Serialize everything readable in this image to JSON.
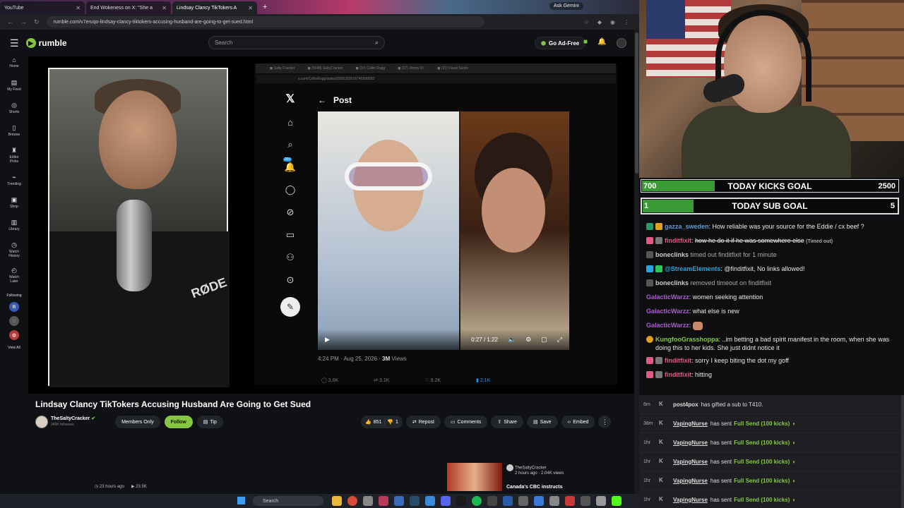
{
  "browser": {
    "tabs": [
      {
        "label": "YouTube",
        "active": false
      },
      {
        "label": "End Wokeness on X: \"She a",
        "active": false
      },
      {
        "label": "Lindsay Clancy TikTokers A",
        "active": true
      }
    ],
    "ask_gemini": "Ask Gemini",
    "url": "rumble.com/v7eruqo-lindsay-clancy-tiktokers-accusing-husband-are-going-to-get-sued.html"
  },
  "header": {
    "logo": "rumble",
    "search_placeholder": "Search",
    "go_ad_free": "Go Ad-Free"
  },
  "sidebar": {
    "items": [
      {
        "label": "Home",
        "icon": "home-icon"
      },
      {
        "label": "My Feed",
        "icon": "feed-icon"
      },
      {
        "label": "Shorts",
        "icon": "shorts-icon"
      },
      {
        "label": "Browse",
        "icon": "browse-icon"
      },
      {
        "label": "Editor Picks",
        "icon": "picks-icon"
      },
      {
        "label": "Trending",
        "icon": "trending-icon"
      },
      {
        "label": "Shop",
        "icon": "shop-icon"
      },
      {
        "label": "Library",
        "icon": "library-icon"
      },
      {
        "label": "Watch History",
        "icon": "history-icon"
      },
      {
        "label": "Watch Later",
        "icon": "later-icon"
      }
    ],
    "following_label": "Following",
    "view_all": "View All"
  },
  "post": {
    "header": "Post",
    "fake_url": "x.com/CollinRugg/status/2092392616746996093",
    "notif_count": "20+",
    "time": "0:27 / 1:22",
    "meta": "4:24 PM · Aug 25, 2026 · ",
    "views": "3M",
    "views_label": " Views",
    "actions": [
      "3.6K",
      "3.1K",
      "9.2K",
      "2.1K"
    ]
  },
  "video": {
    "title": "Lindsay Clancy TikTokers Accusing Husband Are Going to Get Sued",
    "channel": "TheSaltyCracker",
    "followers": "349K followers",
    "members_only": "Members Only",
    "follow": "Follow",
    "tip": "Tip",
    "upvotes": "851",
    "downvotes": "1",
    "repost": "Repost",
    "comments": "Comments",
    "share": "Share",
    "save": "Save",
    "embed": "Embed",
    "posted": "23 hours ago",
    "views": "23.5K"
  },
  "related": {
    "channel": "TheSaltyCracker",
    "meta": "2 hours ago · 2.04K views",
    "title": "Canada's CBC instructs"
  },
  "taskbar": {
    "search": "Search"
  },
  "goals": [
    {
      "current": "700",
      "label": "TODAY KICKS GOAL",
      "target": "2500",
      "progress": 0.28
    },
    {
      "current": "1",
      "label": "TODAY SUB GOAL",
      "target": "5",
      "progress": 0.2
    }
  ],
  "chat": [
    {
      "user": "gazza_sweden",
      "color": "#5b9bd5",
      "text": "How reliable was your source for the Eddie / cx beef ?"
    },
    {
      "user": "finditfixit",
      "color": "#e05a8a",
      "text": "how he do it if he was somewhere else",
      "suffix": "(Timed out)"
    },
    {
      "user": "boneclinks",
      "color": "#cccccc",
      "text": "timed out finditfixit for 1 minute"
    },
    {
      "user": "@StreamElements",
      "color": "#2aa5e0",
      "text": "@finditfixit, No links allowed!"
    },
    {
      "user": "boneclinks",
      "color": "#cccccc",
      "text": "removed timeout on finditfixit"
    },
    {
      "user": "GalacticWarzz",
      "color": "#b05ad8",
      "text": "women seeking attention"
    },
    {
      "user": "GalacticWarzz",
      "color": "#b05ad8",
      "text": "what else is new"
    },
    {
      "user": "GalacticWarzz",
      "color": "#b05ad8",
      "text": ""
    },
    {
      "user": "KungfooGrasshoppa",
      "color": "#85c742",
      "text": "..im betting a bad spirit manifest in the room, when she was doing this to her kids. She just didnt notice it"
    },
    {
      "user": "finditfixit",
      "color": "#e05a8a",
      "text": "sorry I keep biting the dot my goff"
    },
    {
      "user": "finditfixit",
      "color": "#e05a8a",
      "text": "hitting"
    }
  ],
  "kick_events": [
    {
      "time": "8m",
      "user": "post4pox",
      "text": "has gifted a sub to T410."
    },
    {
      "time": "38m",
      "user": "VapingNurse",
      "text": "has sent",
      "highlight": "Full Send (100 kicks)"
    },
    {
      "time": "1hr",
      "user": "VapingNurse",
      "text": "has sent",
      "highlight": "Full Send (100 kicks)"
    },
    {
      "time": "1hr",
      "user": "VapingNurse",
      "text": "has sent",
      "highlight": "Full Send (100 kicks)"
    },
    {
      "time": "1hr",
      "user": "VapingNurse",
      "text": "has sent",
      "highlight": "Full Send (100 kicks)"
    },
    {
      "time": "1hr",
      "user": "VapingNurse",
      "text": "has sent",
      "highlight": "Full Send (100 kicks)"
    }
  ]
}
